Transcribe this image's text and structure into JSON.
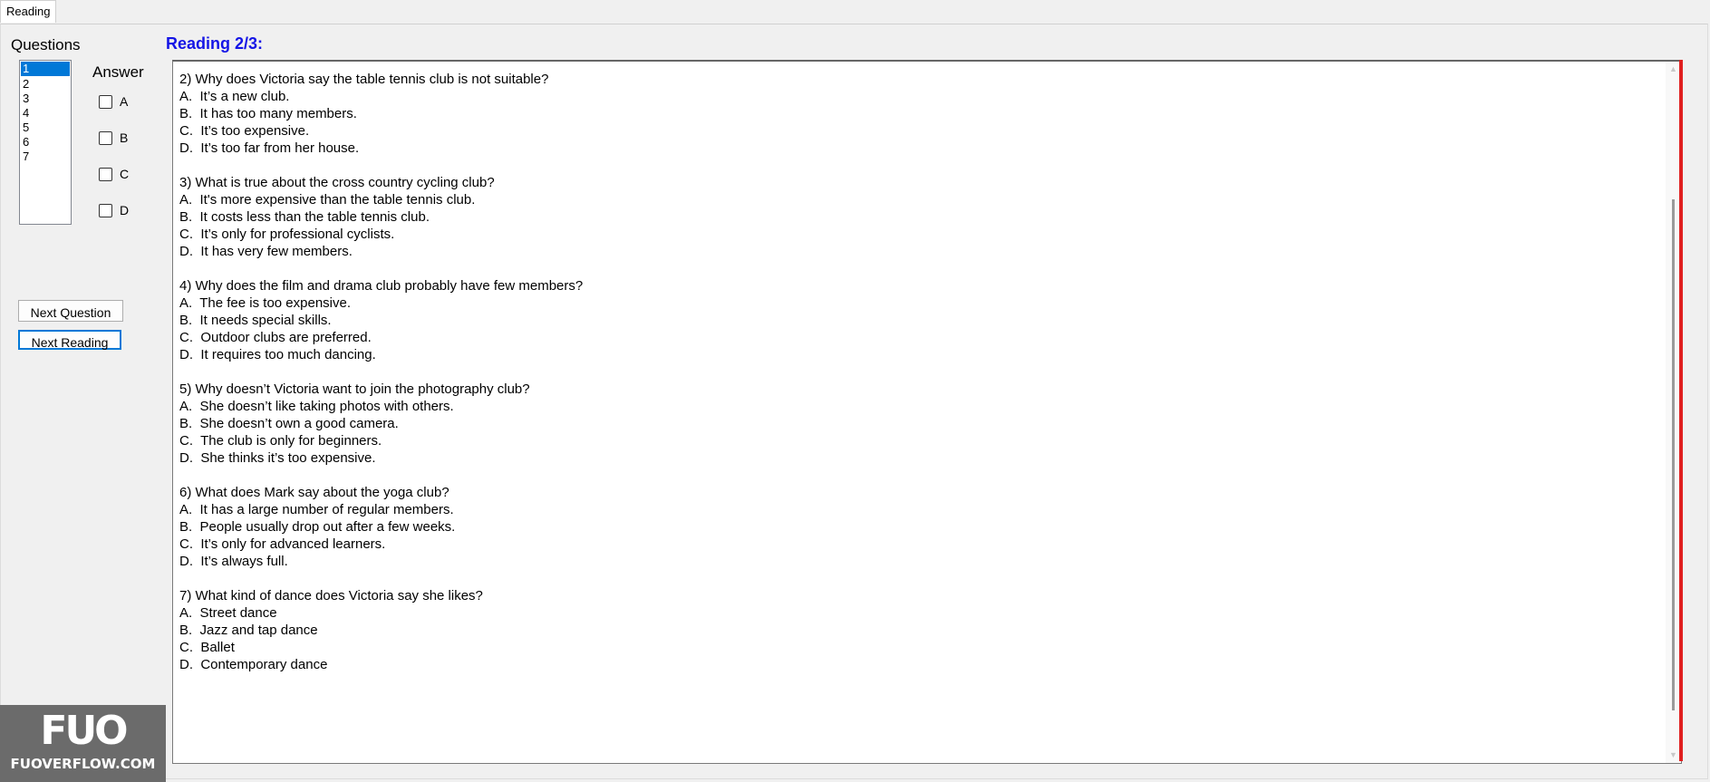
{
  "tab": {
    "label": "Reading"
  },
  "sidebar": {
    "questions_label": "Questions",
    "question_numbers": [
      "1",
      "2",
      "3",
      "4",
      "5",
      "6",
      "7"
    ],
    "answer_label": "Answer",
    "options": [
      "A",
      "B",
      "C",
      "D"
    ],
    "next_question_label": "Next Question",
    "next_reading_label": "Next Reading"
  },
  "reading": {
    "title": "Reading 2/3:",
    "questions": [
      {
        "q": "2) Why does Victoria say the table tennis club is not suitable?",
        "a": [
          "A.  It’s a new club.",
          "B.  It has too many members.",
          "C.  It’s too expensive.",
          "D.  It’s too far from her house."
        ]
      },
      {
        "q": "3) What is true about the cross country cycling club?",
        "a": [
          "A.  It's more expensive than the table tennis club.",
          "B.  It costs less than the table tennis club.",
          "C.  It’s only for professional cyclists.",
          "D.  It has very few members."
        ]
      },
      {
        "q": "4) Why does the film and drama club probably have few members?",
        "a": [
          "A.  The fee is too expensive.",
          "B.  It needs special skills.",
          "C.  Outdoor clubs are preferred.",
          "D.  It requires too much dancing."
        ]
      },
      {
        "q": "5) Why doesn’t Victoria want to join the photography club?",
        "a": [
          "A.  She doesn’t like taking photos with others.",
          "B.  She doesn’t own a good camera.",
          "C.  The club is only for beginners.",
          "D.  She thinks it’s too expensive."
        ]
      },
      {
        "q": "6) What does Mark say about the yoga club?",
        "a": [
          "A.  It has a large number of regular members.",
          "B.  People usually drop out after a few weeks.",
          "C.  It’s only for advanced learners.",
          "D.  It’s always full."
        ]
      },
      {
        "q": "7) What kind of dance does Victoria say she likes?",
        "a": [
          "A.  Street dance",
          "B.  Jazz and tap dance",
          "C.  Ballet",
          "D.  Contemporary dance"
        ]
      }
    ]
  },
  "watermark": {
    "logo": "FUO",
    "text": "FUOVERFLOW.COM"
  },
  "colors": {
    "title_blue": "#1515e6",
    "selection_blue": "#0078d7",
    "red_bar": "#e02020"
  },
  "icons": {
    "scroll_up": "scroll-up-arrow-icon",
    "scroll_down": "scroll-down-arrow-icon"
  }
}
